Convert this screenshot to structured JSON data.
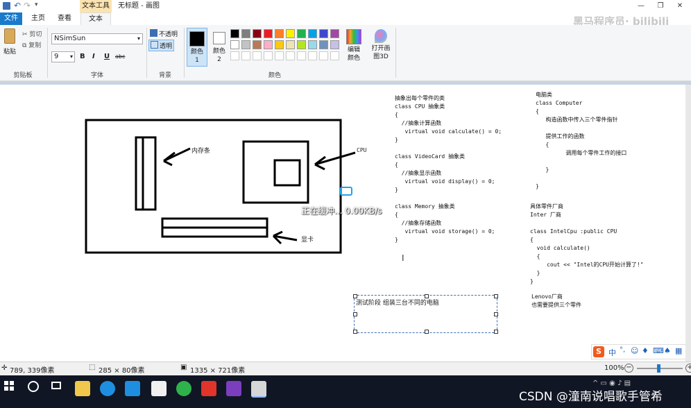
{
  "window": {
    "title": "无标题 - 画图",
    "contextual_tab": "文本工具",
    "watermark": "黑马程序员· bilibili"
  },
  "tabs": {
    "file": "文件",
    "home": "主页",
    "view": "查看",
    "text": "文本"
  },
  "clipboard": {
    "paste": "粘贴",
    "cut": "剪切",
    "copy": "复制",
    "label": "剪贴板"
  },
  "font": {
    "family": "NSimSun",
    "size": "9",
    "bold": "B",
    "italic": "I",
    "underline": "U",
    "strike": "abc",
    "label": "字体"
  },
  "background": {
    "opaque": "不透明",
    "transparent": "透明",
    "label": "背景"
  },
  "colors": {
    "color1": "颜色1",
    "color2": "颜色2",
    "edit": "编辑颜色",
    "paint3d": "打开画图3D",
    "label": "颜色",
    "palette_row1": [
      "#000000",
      "#7f7f7f",
      "#880015",
      "#ed1c24",
      "#ff7f27",
      "#fff200",
      "#22b14c",
      "#00a2e8",
      "#3f48cc",
      "#a349a4"
    ],
    "palette_row2": [
      "#ffffff",
      "#c3c3c3",
      "#b97a57",
      "#ffaec9",
      "#ffc90e",
      "#efe4b0",
      "#b5e61d",
      "#99d9ea",
      "#7092be",
      "#c8bfe7"
    ]
  },
  "canvas": {
    "label_memory": "内存条",
    "label_cpu": "CPU",
    "label_gpu": "显卡",
    "loading": "正在缓冲... 0.00KB/s",
    "code_abstract": "抽象出每个零件的类\nclass CPU 抽象类\n{\n  //抽象计算函数\n   virtual void calculate() = 0;\n}\n\nclass VideoCard 抽象类\n{\n  //抽象显示函数\n   virtual void display() = 0;\n}\n\nclass Memory 抽象类\n{\n  //抽象存储函数\n   virtual void storage() = 0;\n}",
    "code_computer": "电脑类\nclass Computer\n{\n   构造函数中传入三个零件指针\n\n   提供工作的函数\n   {\n         调用每个零件工作的接口\n\n   }\n\n}",
    "code_vendor": "具体零件厂商\nInter 厂商\n\nclass IntelCpu :public CPU\n{\n  void calculate()\n  {\n     cout << \"Intel的CPU开始计算了!\"\n  }\n}",
    "code_lenovo": "Lenovo厂商\n也需要提供三个零件",
    "textbox": "测试阶段 组装三台不同的电脑"
  },
  "status": {
    "cursor_pos": "789, 339像素",
    "selection_size": "285 × 80像素",
    "image_size": "1335 × 721像素",
    "zoom": "100%"
  },
  "ime": {
    "lang": "中"
  },
  "taskbar": {
    "csdn": "CSDN @潼南说唱歌手管希"
  }
}
